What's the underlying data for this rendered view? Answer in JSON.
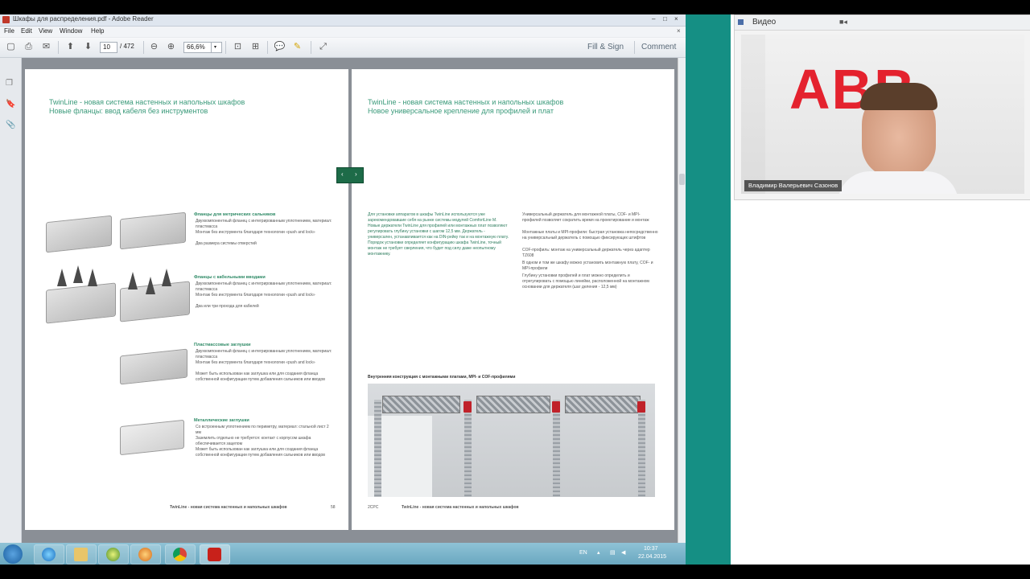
{
  "window": {
    "title": "Шкафы для распределения.pdf - Adobe Reader",
    "controls": [
      "–",
      "□",
      "×"
    ]
  },
  "menu": [
    "File",
    "Edit",
    "View",
    "Window",
    "Help"
  ],
  "toolbar": {
    "page_current": "10",
    "page_total": "/ 472",
    "zoom": "66,6%",
    "fill_sign": "Fill & Sign",
    "comment": "Comment"
  },
  "page_left": {
    "title_line1": "TwinLine - новая система настенных и напольных шкафов",
    "title_line2": "Новые фланцы: ввод кабеля без инструментов",
    "sections": [
      {
        "heading": "Фланцы для метрических сальников",
        "bullets": [
          "Двухкомпонентный фланец с интегрированным уплотнением, материал: пластмасса",
          "Монтаж без инструмента благодаря технологии «push and lock»",
          "Два размера системы отверстий"
        ]
      },
      {
        "heading": "Фланцы с кабельными вводами",
        "bullets": [
          "Двухкомпонентный фланец с интегрированным уплотнением, материал: пластмасса",
          "Монтаж без инструмента благодаря технологии «push and lock»",
          "Два или три прохода для кабелей"
        ]
      },
      {
        "heading": "Пластмассовые заглушки",
        "bullets": [
          "Двухкомпонентный фланец с интегрированным уплотнением, материал: пластмасса",
          "Монтаж без инструмента благодаря технологии «push and lock»",
          "Может быть использован как заглушка или для создания фланца собственной конфигурации путем добавления сальников или вводов"
        ]
      },
      {
        "heading": "Металлические заглушки",
        "bullets": [
          "Со встроенным уплотнением по периметру, материал: стальной лист 2 мм",
          "Заземлить отдельно не требуется: контакт с корпусом шкафа обеспечивается зацепом",
          "Может быть использован как заглушка или для создания фланца собственной конфигурации путем добавления сальников или вводов"
        ]
      }
    ],
    "footer_title": "TwinLine - новая система настенных и напольных шкафов",
    "footer_num": "58"
  },
  "page_right": {
    "title_line1": "TwinLine - новая система настенных и напольных шкафов",
    "title_line2": "Новое универсальное крепление для профилей и плат",
    "intro": "Для установки аппаратов в шкафы TwinLine используются уже зарекомендовавшие себя на рынке системы модулей ComfortLine M. Новые держатели TwinLine для профилей или монтажных плат позволяют регулировать глубину установки с шагом 12,5 мм. Держатель - универсален, устанавливается как на DIN-рейку так и на монтажную плату. Порядок установки определяет конфигурацию шкафа TwinLine, точный монтаж не требует сверления, что будет под силу даже неопытному монтажнику.",
    "bullets": [
      "Универсальный держатель для монтажной платы, COF- и MPI-профилей позволяет сократить время на проектирование и монтаж",
      "Монтажные платы и MPI-профили: быстрая установка непосредственно на универсальный держатель с помощью фиксирующих штифтов",
      "COF-профиль: монтаж на универсальный держатель через адаптер TZ608",
      "В одном и том же шкафу можно установить монтажную плату, COF- и MPI-профили",
      "Глубину установки профилей и плат можно определить и отрегулировать с помощью линейки, расположенной на монтажном основании для держателя (шаг деления - 12,5 мм)"
    ],
    "photo_caption": "Внутренняя конструкция с монтажными платами, MPI- и COF-профилями",
    "footer_num": "2CPC",
    "footer_title": "TwinLine - новая система настенных и напольных шкафов"
  },
  "nav_button": [
    "‹",
    "›"
  ],
  "video": {
    "label": "Видео",
    "logo_text": "ABB",
    "presenter": "Владимир Валерьевич Сазонов"
  },
  "taskbar": {
    "lang": "EN",
    "time": "10:37",
    "date": "22.04.2015"
  }
}
